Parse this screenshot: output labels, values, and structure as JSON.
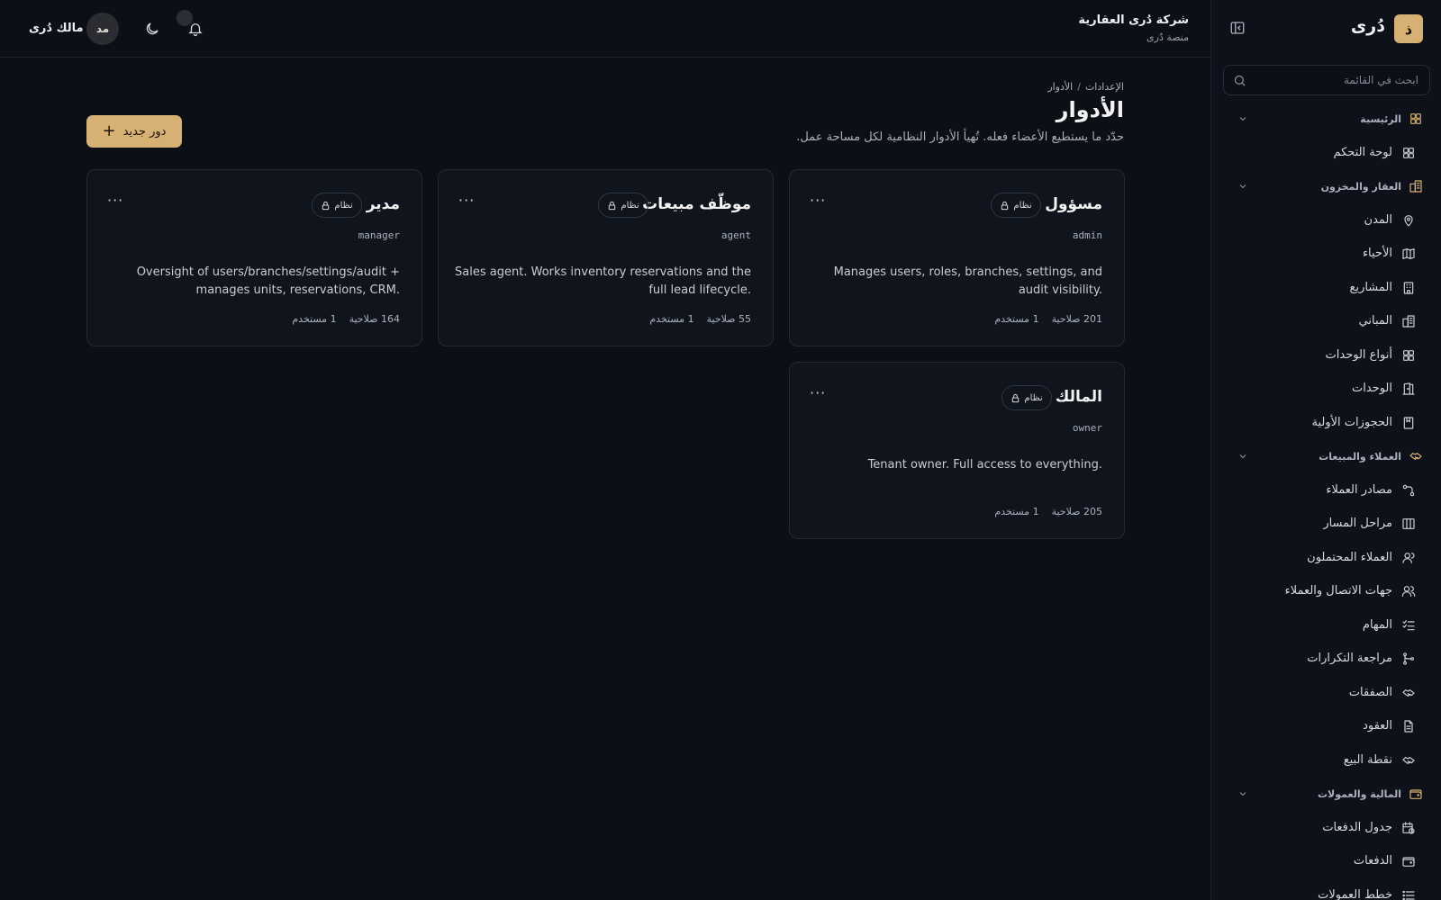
{
  "sidebar": {
    "logo_letter": "ذ",
    "logo_name": "دُرى",
    "search_placeholder": "ابحث في القائمة",
    "sections": [
      {
        "label": "الرئيسية",
        "items": [
          {
            "label": "لوحة التحكم",
            "icon": "dashboard-icon"
          }
        ]
      },
      {
        "label": "العقار والمخزون",
        "items": [
          {
            "label": "المدن",
            "icon": "map-pin-icon"
          },
          {
            "label": "الأحياء",
            "icon": "map-icon"
          },
          {
            "label": "المشاريع",
            "icon": "building-icon"
          },
          {
            "label": "المباني",
            "icon": "buildings-icon"
          },
          {
            "label": "أنواع الوحدات",
            "icon": "grid-icon"
          },
          {
            "label": "الوحدات",
            "icon": "door-icon"
          },
          {
            "label": "الحجوزات الأولية",
            "icon": "bookmark-icon"
          }
        ]
      },
      {
        "label": "العملاء والمبيعات",
        "items": [
          {
            "label": "مصادر العملاء",
            "icon": "source-icon"
          },
          {
            "label": "مراحل المسار",
            "icon": "kanban-icon"
          },
          {
            "label": "العملاء المحتملون",
            "icon": "user-icon"
          },
          {
            "label": "جهات الاتصال والعملاء",
            "icon": "users-icon"
          },
          {
            "label": "المهام",
            "icon": "tasks-icon"
          },
          {
            "label": "مراجعة التكرارات",
            "icon": "merge-icon"
          },
          {
            "label": "الصفقات",
            "icon": "handshake-icon"
          },
          {
            "label": "العقود",
            "icon": "document-icon"
          },
          {
            "label": "نقطة البيع",
            "icon": "handshake-icon"
          }
        ]
      },
      {
        "label": "المالية والعمولات",
        "items": [
          {
            "label": "جدول الدفعات",
            "icon": "calendar-clock-icon"
          },
          {
            "label": "الدفعات",
            "icon": "wallet-icon"
          },
          {
            "label": "خطط العمولات",
            "icon": "list-icon"
          }
        ]
      }
    ]
  },
  "topbar": {
    "org_name": "شركة دُرى العقارية",
    "org_sub": "منصة دُرى",
    "user_name": "مالك دُرى",
    "avatar_initials": "مد"
  },
  "page": {
    "breadcrumb": [
      "الإعدادات",
      "الأدوار"
    ],
    "title": "الأدوار",
    "subtitle": "حدّد ما يستطيع الأعضاء فعله. تُهيأ الأدوار النظامية لكل مساحة عمل.",
    "new_button": "دور جديد"
  },
  "roles": [
    {
      "title": "مسؤول",
      "badge": "نظام",
      "slug": "admin",
      "desc": "Manages users, roles, branches, settings, and audit visibility.",
      "perms": "201 صلاحية",
      "users": "1 مستخدم"
    },
    {
      "title": "موظّف مبيعات",
      "badge": "نظام",
      "slug": "agent",
      "desc": "Sales agent. Works inventory reservations and the full lead lifecycle.",
      "perms": "55 صلاحية",
      "users": "1 مستخدم"
    },
    {
      "title": "مدير",
      "badge": "نظام",
      "slug": "manager",
      "desc": "Oversight of users/branches/settings/audit + manages units, reservations, CRM.",
      "perms": "164 صلاحية",
      "users": "1 مستخدم"
    },
    {
      "title": "المالك",
      "badge": "نظام",
      "slug": "owner",
      "desc": "Tenant owner. Full access to everything.",
      "perms": "205 صلاحية",
      "users": "1 مستخدم"
    }
  ],
  "colors": {
    "accent": "#d7b073",
    "background": "#0c0f16",
    "card": "#10141c"
  }
}
